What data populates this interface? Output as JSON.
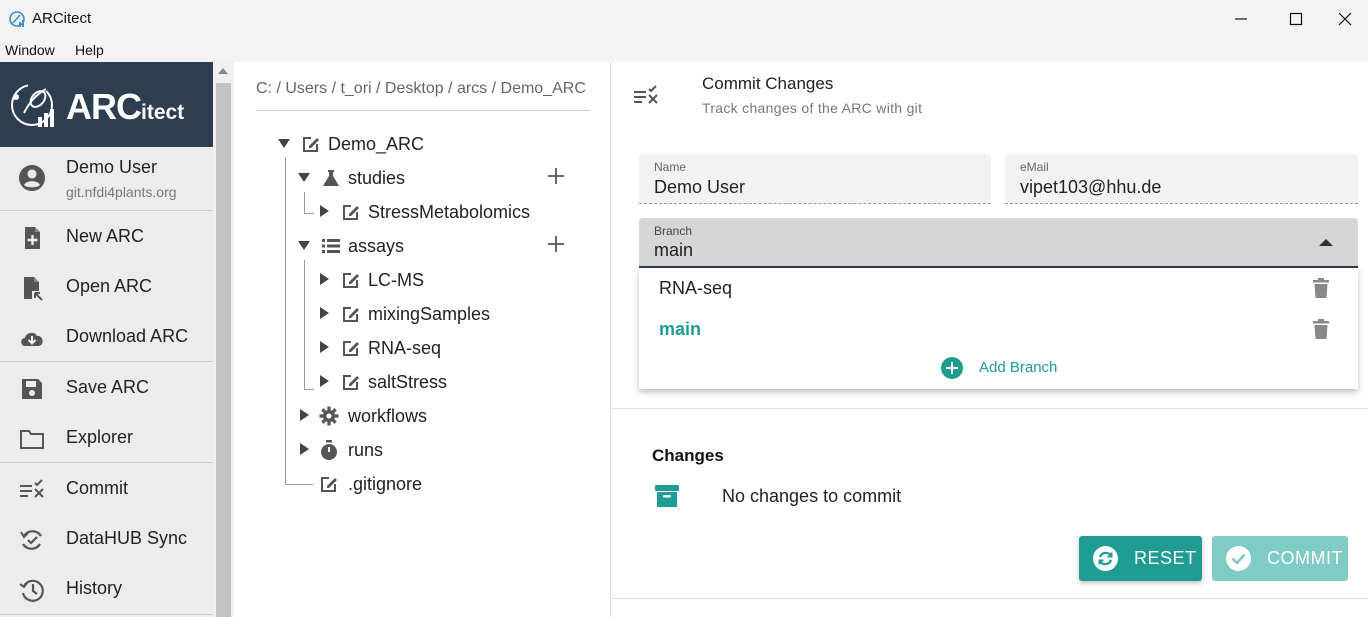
{
  "window": {
    "title": "ARCitect",
    "menu": [
      "Window",
      "Help"
    ]
  },
  "sidebar": {
    "logo": {
      "main": "ARC",
      "suffix": "itect"
    },
    "user": {
      "name": "Demo User",
      "host": "git.nfdi4plants.org"
    },
    "items": [
      {
        "label": "New ARC",
        "icon": "new-file-icon"
      },
      {
        "label": "Open ARC",
        "icon": "open-file-icon"
      },
      {
        "label": "Download ARC",
        "icon": "cloud-download-icon"
      },
      {
        "label": "Save ARC",
        "icon": "save-icon"
      },
      {
        "label": "Explorer",
        "icon": "folder-icon"
      },
      {
        "label": "Commit",
        "icon": "commit-icon"
      },
      {
        "label": "DataHUB Sync",
        "icon": "sync-icon"
      },
      {
        "label": "History",
        "icon": "history-icon"
      }
    ]
  },
  "tree": {
    "breadcrumb": "C: / Users / t_ori / Desktop / arcs / Demo_ARC",
    "root": "Demo_ARC",
    "studies": "studies",
    "study_items": [
      "StressMetabolomics"
    ],
    "assays": "assays",
    "assay_items": [
      "LC-MS",
      "mixingSamples",
      "RNA-seq",
      "saltStress"
    ],
    "workflows": "workflows",
    "runs": "runs",
    "gitignore": ".gitignore"
  },
  "commit": {
    "title": "Commit Changes",
    "subtitle": "Track changes of the ARC with git",
    "name_label": "Name",
    "name_value": "Demo User",
    "email_label": "eMail",
    "email_value": "vipet103@hhu.de",
    "branch_label": "Branch",
    "branch_value": "main",
    "branches": [
      "RNA-seq",
      "main"
    ],
    "add_branch": "Add Branch",
    "changes_title": "Changes",
    "no_changes": "No changes to commit",
    "reset_label": "RESET",
    "commit_label": "COMMIT"
  },
  "colors": {
    "accent": "#1f9c93",
    "accent_disabled": "#7fcbc6",
    "sidebar_header": "#2d3e50"
  }
}
